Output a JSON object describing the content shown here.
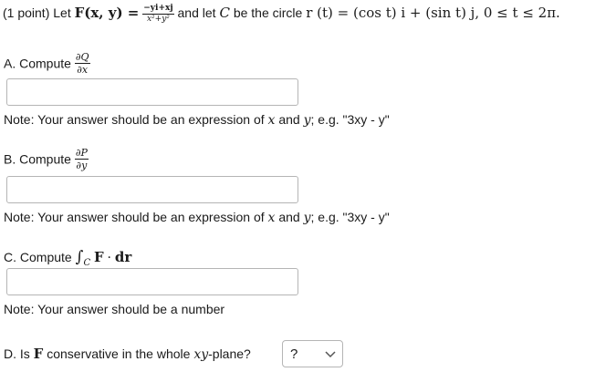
{
  "header": {
    "points": "(1 point)",
    "let": "Let",
    "F_def": "F(x, y) =",
    "frac_num": "−yi+xj",
    "frac_den": "x²+y²",
    "and_let": "and let",
    "C": "C",
    "be_circle": "be the circle",
    "r_def": "r (t) = (cos t) i + (sin t) j, 0 ≤ t ≤ 2π."
  },
  "partA": {
    "label": "A. Compute",
    "num": "∂Q",
    "den": "∂x",
    "input_value": "",
    "note_pre": "Note: Your answer should be an expression of",
    "var_x": "x",
    "note_and": "and",
    "var_y": "y",
    "note_post": "; e.g. \"3xy - y\""
  },
  "partB": {
    "label": "B. Compute",
    "num": "∂P",
    "den": "∂y",
    "input_value": "",
    "note_pre": "Note: Your answer should be an expression of",
    "var_x": "x",
    "note_and": "and",
    "var_y": "y",
    "note_post": "; e.g. \"3xy - y\""
  },
  "partC": {
    "label": "C. Compute",
    "integral": "∫",
    "sub": "C",
    "expr_F": "F",
    "expr_dot": "·",
    "expr_dr": "dr",
    "input_value": "",
    "note": "Note: Your answer should be a number"
  },
  "partD": {
    "label_pre": "D. Is",
    "F": "F",
    "label_mid": "conservative in the whole",
    "plane_var": "xy",
    "label_post": "-plane?",
    "select_value": "?",
    "icon": "chevron-down-icon"
  }
}
